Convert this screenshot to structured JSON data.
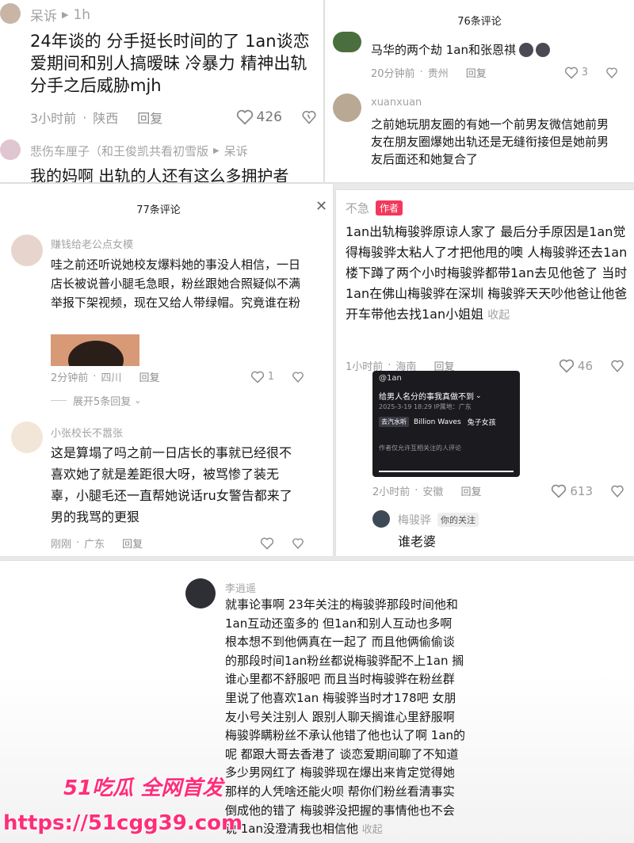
{
  "top_left": {
    "c1": {
      "user": "呆诉",
      "time_ago": "1h"
    },
    "c2": {
      "text": "24年谈的 分手挺长时间的了 1an谈恋爱期间和别人搞暧昧 冷暴力 精神出轨 分手之后威胁mjh",
      "time": "3小时前",
      "location": "陕西",
      "reply": "回复",
      "likes": "426"
    },
    "c3": {
      "user": "悲伤车厘子（和王俊凯共看初雪版",
      "reply_to": "呆诉",
      "text": "我的妈啊 出轨的人还有这么多拥护者"
    }
  },
  "top_right": {
    "count": "76条评论",
    "c1": {
      "text": "马华的两个劫 1an和张恩祺",
      "time": "20分钟前",
      "location": "贵州",
      "reply": "回复",
      "likes": "3"
    },
    "c2": {
      "user": "xuanxuan",
      "text": "之前她玩朋友圈的有她一个前男友微信她前男友在朋友圈爆她出轨还是无缝衔接但是她前男友后面还和她复合了"
    }
  },
  "mid_left": {
    "count": "77条评论",
    "c1": {
      "user": "赚钱给老公点女模",
      "text": "哇之前还听说她校友爆料她的事没人相信，一日店长被说普小腿毛急眼，粉丝跟她合照疑似不满举报下架视频，现在又给人带绿帽。究竟谁在粉",
      "time": "2分钟前",
      "location": "四川",
      "reply": "回复",
      "likes": "1"
    },
    "expand": "展开5条回复",
    "c2": {
      "user": "小张校长不嚣张",
      "text": "这是算塌了吗之前一日店长的事就已经很不喜欢她了就是差距很大呀，被骂惨了装无辜，小腿毛还一直帮她说话ru女警告都来了男的我骂的更狠",
      "time": "刚刚",
      "location": "广东",
      "reply": "回复"
    }
  },
  "mid_right": {
    "c1": {
      "user": "不急",
      "badge": "作者",
      "text": "1an出轨梅骏骅原谅人家了 最后分手原因是1an觉得梅骏骅太粘人了才把他甩的噢 人梅骏骅还去1an楼下蹲了两个小时梅骏骅都带1an去见他爸了 当时1an在佛山梅骏骅在深圳 梅骏骅天天吵他爸让他爸开车带他去找1an小姐姐",
      "collapse": "收起",
      "time": "1小时前",
      "location": "海南",
      "reply": "回复",
      "likes": "46"
    },
    "card": {
      "handle": "@1an",
      "title": "给男人名分的事我真做不到",
      "meta": "2025-3-19 18:29  IP属地：广东",
      "tag": "去汽水听",
      "song": "Billion Waves",
      "song2": "兔子女孩",
      "footer": "作者仅允许互相关注的人评论"
    },
    "c1_stats": {
      "time": "2小时前",
      "location": "安徽",
      "reply": "回复",
      "likes": "613"
    },
    "c2": {
      "user": "梅骏骅",
      "tag": "你的关注",
      "text": "谁老婆"
    }
  },
  "bottom": {
    "c1": {
      "user": "李逍遥",
      "text": "就事论事啊 23年关注的梅骏骅那段时间他和1an互动还蛮多的 但1an和别人互动也多啊 根本想不到他俩真在一起了 而且他俩偷偷谈的那段时间1an粉丝都说梅骏骅配不上1an 搁谁心里都不舒服吧 而且当时梅骏骅在粉丝群里说了他喜欢1an 梅骏骅当时才178吧 女朋友小号关注别人 跟别人聊天搁谁心里舒服啊 梅骏骅瞒粉丝不承认他错了他也认了啊 1an的呢 都跟大哥去香港了 谈恋爱期间聊了不知道多少男网红了 梅骏骅现在爆出来肯定觉得她那样的人凭啥还能火呗 帮你们粉丝看清事实倒成他的错了 梅骏骅没把握的事情他也不会说 1an没澄清我也相信他",
      "collapse": "收起"
    }
  },
  "watermark": {
    "brand": "51吃瓜 全网首发",
    "url": "https://51cgg39.com"
  }
}
